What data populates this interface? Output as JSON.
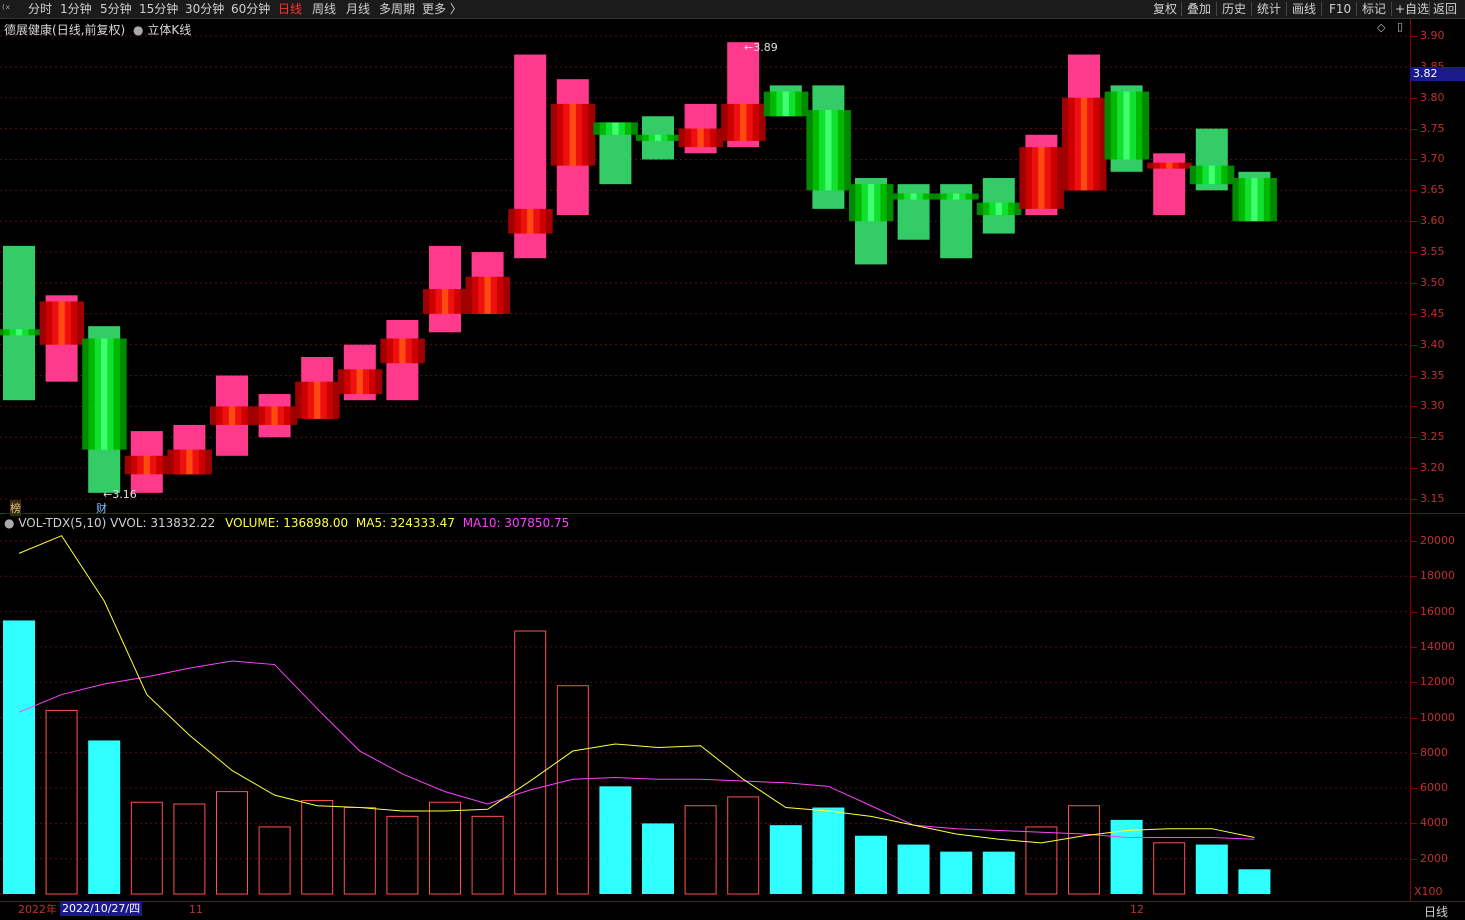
{
  "toolbar": {
    "periods": [
      {
        "label": "分时",
        "active": false
      },
      {
        "label": "1分钟",
        "active": false
      },
      {
        "label": "5分钟",
        "active": false
      },
      {
        "label": "15分钟",
        "active": false
      },
      {
        "label": "30分钟",
        "active": false
      },
      {
        "label": "60分钟",
        "active": false
      },
      {
        "label": "日线",
        "active": true
      },
      {
        "label": "周线",
        "active": false
      },
      {
        "label": "月线",
        "active": false
      },
      {
        "label": "多周期",
        "active": false
      },
      {
        "label": "更多 〉",
        "active": false
      }
    ],
    "right": [
      "复权",
      "叠加",
      "历史",
      "统计",
      "画线",
      "F10",
      "标记",
      "+自选",
      "返回"
    ]
  },
  "title": {
    "stock": "德展健康",
    "mode": "(日线,前复权)",
    "chart_style": "立体K线"
  },
  "price_axis": {
    "ticks": [
      "3.90",
      "3.85",
      "3.80",
      "3.75",
      "3.70",
      "3.65",
      "3.60",
      "3.55",
      "3.50",
      "3.45",
      "3.40",
      "3.35",
      "3.30",
      "3.25",
      "3.20",
      "3.15"
    ],
    "last_price": "3.82"
  },
  "annotations": {
    "high_label": "3.89",
    "low_label": "3.16",
    "badge_rank": "榜",
    "badge_fin": "财"
  },
  "indicator": {
    "name": "VOL-TDX(5,10)",
    "vvol": "VVOL: 313832.22",
    "volume": "VOLUME: 136898.00",
    "ma5": "MA5: 324333.47",
    "ma10": "MA10: 307850.75",
    "colors": {
      "name": "#d0d0d0",
      "vvol": "#d0d0d0",
      "volume": "#ffff40",
      "ma5": "#ffff40",
      "ma10": "#ff40ff"
    }
  },
  "volume_axis": {
    "ticks": [
      "20000",
      "18000",
      "16000",
      "14000",
      "12000",
      "10000",
      "8000",
      "6000",
      "4000",
      "2000"
    ],
    "multiplier": "X100"
  },
  "x_axis": {
    "year": "2022年",
    "cursor_date": "2022/10/27/四",
    "month_11": "11",
    "month_12": "12",
    "period_label": "日线"
  },
  "chart_data": {
    "type": "candlestick",
    "price_range": [
      3.13,
      3.92
    ],
    "candles": [
      {
        "open": 3.42,
        "close": 3.42,
        "high": 3.56,
        "low": 3.31,
        "up": false
      },
      {
        "open": 3.4,
        "close": 3.47,
        "high": 3.48,
        "low": 3.34,
        "up": true
      },
      {
        "open": 3.41,
        "close": 3.23,
        "high": 3.43,
        "low": 3.16,
        "up": false
      },
      {
        "open": 3.19,
        "close": 3.22,
        "high": 3.26,
        "low": 3.16,
        "up": true
      },
      {
        "open": 3.19,
        "close": 3.23,
        "high": 3.27,
        "low": 3.19,
        "up": true
      },
      {
        "open": 3.27,
        "close": 3.3,
        "high": 3.35,
        "low": 3.22,
        "up": true
      },
      {
        "open": 3.27,
        "close": 3.3,
        "high": 3.32,
        "low": 3.25,
        "up": true
      },
      {
        "open": 3.28,
        "close": 3.34,
        "high": 3.38,
        "low": 3.28,
        "up": true
      },
      {
        "open": 3.32,
        "close": 3.36,
        "high": 3.4,
        "low": 3.31,
        "up": true
      },
      {
        "open": 3.37,
        "close": 3.41,
        "high": 3.44,
        "low": 3.31,
        "up": true
      },
      {
        "open": 3.45,
        "close": 3.49,
        "high": 3.56,
        "low": 3.42,
        "up": true
      },
      {
        "open": 3.45,
        "close": 3.51,
        "high": 3.55,
        "low": 3.45,
        "up": true
      },
      {
        "open": 3.58,
        "close": 3.62,
        "high": 3.87,
        "low": 3.54,
        "up": true
      },
      {
        "open": 3.69,
        "close": 3.79,
        "high": 3.83,
        "low": 3.61,
        "up": true
      },
      {
        "open": 3.74,
        "close": 3.76,
        "high": 3.76,
        "low": 3.66,
        "up": false
      },
      {
        "open": 3.73,
        "close": 3.74,
        "high": 3.77,
        "low": 3.7,
        "up": false
      },
      {
        "open": 3.72,
        "close": 3.75,
        "high": 3.79,
        "low": 3.71,
        "up": true
      },
      {
        "open": 3.73,
        "close": 3.79,
        "high": 3.89,
        "low": 3.72,
        "up": true
      },
      {
        "open": 3.81,
        "close": 3.77,
        "high": 3.82,
        "low": 3.77,
        "up": false
      },
      {
        "open": 3.78,
        "close": 3.65,
        "high": 3.82,
        "low": 3.62,
        "up": false
      },
      {
        "open": 3.66,
        "close": 3.6,
        "high": 3.67,
        "low": 3.53,
        "up": false
      },
      {
        "open": 3.64,
        "close": 3.64,
        "high": 3.66,
        "low": 3.57,
        "up": false
      },
      {
        "open": 3.64,
        "close": 3.64,
        "high": 3.66,
        "low": 3.54,
        "up": false
      },
      {
        "open": 3.63,
        "close": 3.61,
        "high": 3.67,
        "low": 3.58,
        "up": false
      },
      {
        "open": 3.62,
        "close": 3.72,
        "high": 3.74,
        "low": 3.61,
        "up": true
      },
      {
        "open": 3.65,
        "close": 3.8,
        "high": 3.87,
        "low": 3.65,
        "up": true
      },
      {
        "open": 3.7,
        "close": 3.81,
        "high": 3.82,
        "low": 3.68,
        "up": false
      },
      {
        "open": 3.69,
        "close": 3.69,
        "high": 3.71,
        "low": 3.61,
        "up": true
      },
      {
        "open": 3.69,
        "close": 3.66,
        "high": 3.75,
        "low": 3.65,
        "up": false
      },
      {
        "open": 3.67,
        "close": 3.6,
        "high": 3.68,
        "low": 3.6,
        "up": false
      }
    ],
    "volume_range": [
      0,
      21000
    ],
    "volumes": [
      15500,
      10400,
      8700,
      5200,
      5100,
      5800,
      3800,
      5300,
      4900,
      4400,
      5200,
      4400,
      14900,
      11800,
      6100,
      4000,
      5000,
      5500,
      3900,
      4900,
      3300,
      2800,
      2400,
      2400,
      3800,
      5000,
      4200,
      2900,
      2800,
      1400
    ],
    "ma5": [
      19300,
      20300,
      16600,
      11300,
      9000,
      7000,
      5600,
      5000,
      4900,
      4700,
      4700,
      4800,
      6400,
      8100,
      8500,
      8300,
      8400,
      6500,
      4900,
      4700,
      4400,
      3900,
      3400,
      3100,
      2900,
      3300,
      3600,
      3700,
      3700,
      3200
    ],
    "ma10": [
      10300,
      11300,
      11900,
      12300,
      12800,
      13200,
      13000,
      10500,
      8100,
      6800,
      5800,
      5100,
      5900,
      6500,
      6600,
      6500,
      6500,
      6400,
      6300,
      6100,
      5000,
      3900,
      3700,
      3600,
      3500,
      3400,
      3200,
      3200,
      3200,
      3100
    ]
  }
}
